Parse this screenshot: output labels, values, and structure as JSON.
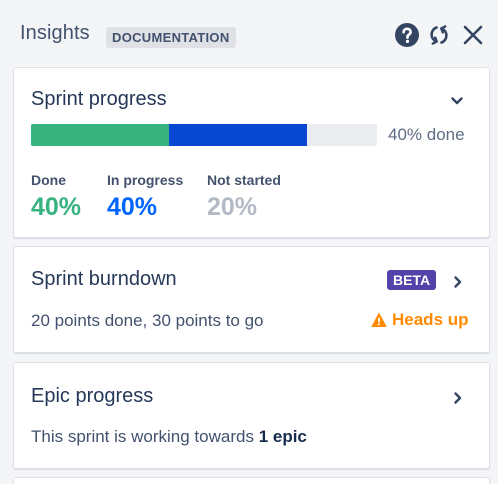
{
  "header": {
    "title": "Insights",
    "badge": "DOCUMENTATION",
    "icons": [
      "help-icon",
      "refresh-icon",
      "close-icon"
    ]
  },
  "sprint_progress": {
    "title": "Sprint progress",
    "done_fraction": 0.4,
    "in_progress_fraction": 0.4,
    "not_started_fraction": 0.2,
    "summary": "40% done",
    "stats": [
      {
        "label": "Done",
        "value": "40%",
        "color": "#36b37e"
      },
      {
        "label": "In progress",
        "value": "40%",
        "color": "#0065ff"
      },
      {
        "label": "Not started",
        "value": "20%",
        "color": "#b3bac5"
      }
    ]
  },
  "sprint_burndown": {
    "title": "Sprint burndown",
    "badge": "BETA",
    "subtitle": "20 points done, 30 points to go",
    "warning": "Heads up"
  },
  "epic_progress": {
    "title": "Epic progress",
    "subtitle_prefix": "This sprint is working towards ",
    "subtitle_bold": "1 epic"
  },
  "colors": {
    "accent_green": "#36b37e",
    "accent_blue": "#0747d1",
    "beta": "#5243aa",
    "warning": "#ff8b00"
  }
}
